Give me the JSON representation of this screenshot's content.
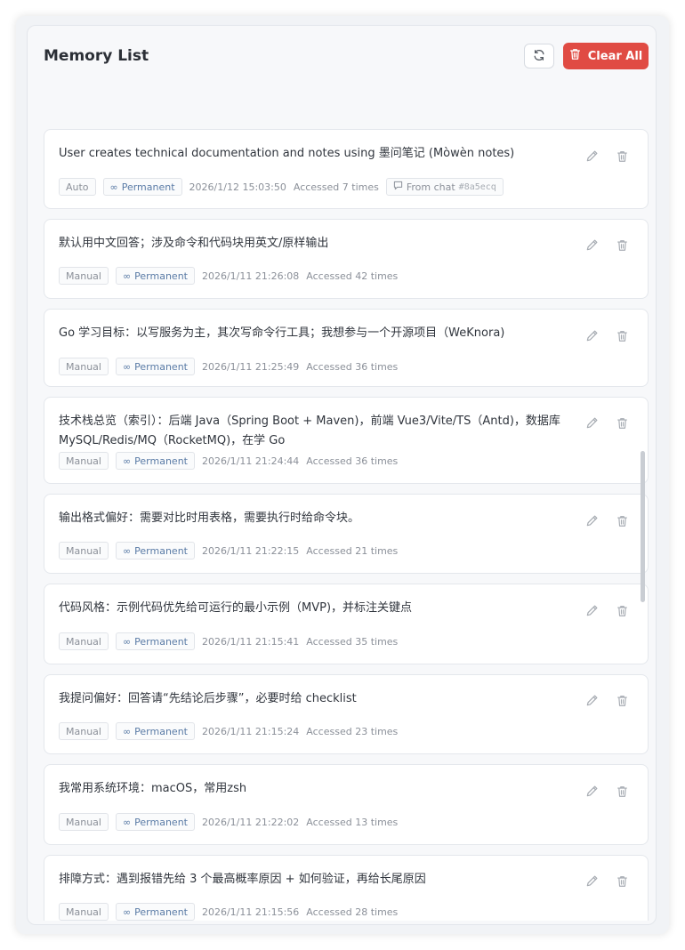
{
  "header": {
    "title": "Memory List",
    "clear_label": "Clear All"
  },
  "colors": {
    "accent_danger": "#e04b43",
    "permanent_tag": "#5a7ba6"
  },
  "memories": [
    {
      "text": "User creates technical documentation and notes using 墨问笔记 (Mòwèn notes)",
      "source": "Auto",
      "duration": "Permanent",
      "timestamp": "2026/1/12 15:03:50",
      "accessed": "Accessed 7 times",
      "from_chat": "From chat",
      "chat_id": "#8a5ecq"
    },
    {
      "text": "默认用中文回答；涉及命令和代码块用英文/原样输出",
      "source": "Manual",
      "duration": "Permanent",
      "timestamp": "2026/1/11 21:26:08",
      "accessed": "Accessed 42 times"
    },
    {
      "text": "Go 学习目标：以写服务为主，其次写命令行工具；我想参与一个开源项目（WeKnora)",
      "source": "Manual",
      "duration": "Permanent",
      "timestamp": "2026/1/11 21:25:49",
      "accessed": "Accessed 36 times"
    },
    {
      "text": "技术栈总览（索引）：后端 Java（Spring Boot + Maven)，前端 Vue3/Vite/TS（Antd)，数据库 MySQL/Redis/MQ（RocketMQ)，在学 Go",
      "source": "Manual",
      "duration": "Permanent",
      "timestamp": "2026/1/11 21:24:44",
      "accessed": "Accessed 36 times"
    },
    {
      "text": "输出格式偏好：需要对比时用表格，需要执行时给命令块。",
      "source": "Manual",
      "duration": "Permanent",
      "timestamp": "2026/1/11 21:22:15",
      "accessed": "Accessed 21 times"
    },
    {
      "text": "代码风格：示例代码优先给可运行的最小示例（MVP)，并标注关键点",
      "source": "Manual",
      "duration": "Permanent",
      "timestamp": "2026/1/11 21:15:41",
      "accessed": "Accessed 35 times"
    },
    {
      "text": "我提问偏好：回答请“先结论后步骤”，必要时给 checklist",
      "source": "Manual",
      "duration": "Permanent",
      "timestamp": "2026/1/11 21:15:24",
      "accessed": "Accessed 23 times"
    },
    {
      "text": "我常用系统环境：macOS，常用zsh",
      "source": "Manual",
      "duration": "Permanent",
      "timestamp": "2026/1/11 21:22:02",
      "accessed": "Accessed 13 times"
    },
    {
      "text": "排障方式：遇到报错先给 3 个最高概率原因 + 如何验证，再给长尾原因",
      "source": "Manual",
      "duration": "Permanent",
      "timestamp": "2026/1/11 21:15:56",
      "accessed": "Accessed 28 times"
    }
  ]
}
